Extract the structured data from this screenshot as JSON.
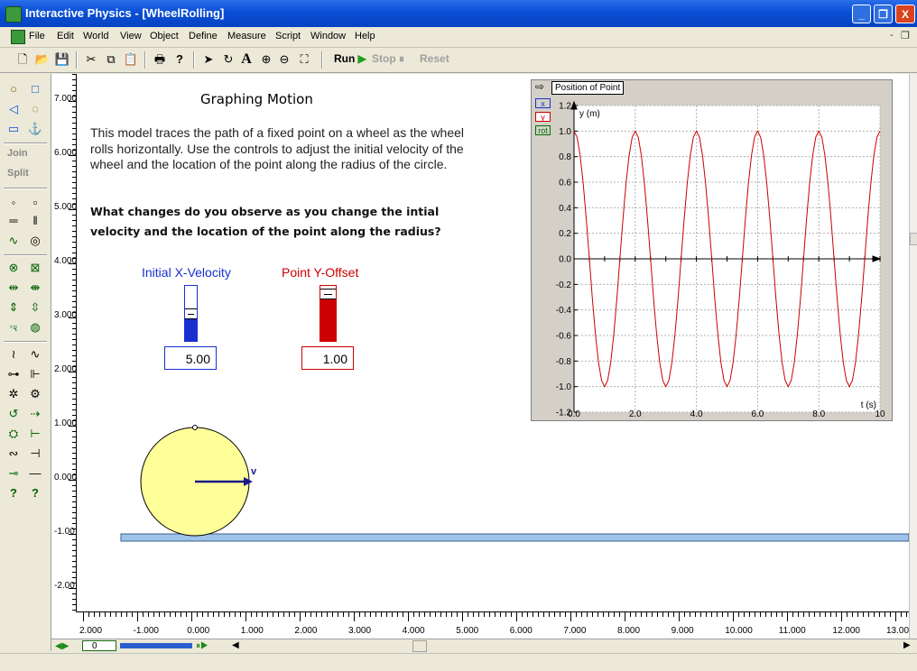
{
  "window": {
    "title": "Interactive Physics - [WheelRolling]",
    "controls": [
      "_",
      "❐",
      "X"
    ]
  },
  "menu": {
    "items": [
      "File",
      "Edit",
      "World",
      "View",
      "Object",
      "Define",
      "Measure",
      "Script",
      "Window",
      "Help"
    ],
    "mdi_controls": [
      "-",
      "❐"
    ]
  },
  "toolbar": {
    "run_label": "Run",
    "stop_label": "Stop",
    "reset_label": "Reset",
    "text_tool": "A"
  },
  "palette": {
    "join_label": "Join",
    "split_label": "Split"
  },
  "content": {
    "heading": "Graphing Motion",
    "description": "This model traces the path of a fixed point on a wheel as the wheel rolls horizontally.  Use the controls to adjust the initial velocity of the wheel and the location of the point along the radius of the circle.",
    "question": "What changes do you observe as you change the intial velocity and the location of the point along the radius?"
  },
  "controls": {
    "velocity": {
      "label": "Initial X-Velocity",
      "value": "5.00",
      "color": "#1a2fd0",
      "level": 0.5
    },
    "offset": {
      "label": "Point  Y-Offset",
      "value": "1.00",
      "color": "#cc0000",
      "level": 0.85
    }
  },
  "scene": {
    "velocity_label": "v",
    "wheel_color": "#ffff99",
    "ground_color": "#9fc3ea"
  },
  "rulers": {
    "vertical": [
      "7.000",
      "6.000",
      "5.000",
      "4.000",
      "3.000",
      "2.000",
      "1.000",
      "0.000",
      "-1.00",
      "-2.00"
    ],
    "horizontal": [
      "2.000",
      "-1.000",
      "0.000",
      "1.000",
      "2.000",
      "3.000",
      "4.000",
      "5.000",
      "6.000",
      "7.000",
      "8.000",
      "9.000",
      "10.000",
      "11.000",
      "12.000",
      "13.00"
    ]
  },
  "frame": {
    "value": "0"
  },
  "graph": {
    "window_title": "Position of Point",
    "legend": [
      "x",
      "y",
      "rot"
    ],
    "chart_data": {
      "type": "line",
      "ylabel": "y (m)",
      "xlabel": "t (s)",
      "xlim": [
        0,
        10
      ],
      "ylim": [
        -1.2,
        1.2
      ],
      "x_ticks": [
        "0.0",
        "2.0",
        "4.0",
        "6.0",
        "8.0",
        "10"
      ],
      "y_ticks": [
        "1.2",
        "1.0",
        "0.8",
        "0.6",
        "0.4",
        "0.2",
        "0.0",
        "-0.2",
        "-0.4",
        "-0.6",
        "-0.8",
        "-1.0",
        "-1.2"
      ],
      "grid": true,
      "series": [
        {
          "color": "#cc0000",
          "x": [
            0,
            0.1,
            0.2,
            0.3,
            0.4,
            0.5,
            0.6,
            0.7,
            0.8,
            0.9,
            1.0,
            1.1,
            1.2,
            1.3,
            1.4,
            1.5,
            1.6,
            1.7,
            1.8,
            1.9,
            2.0,
            2.1,
            2.2,
            2.3,
            2.4,
            2.5,
            2.6,
            2.7,
            2.8,
            2.9,
            3.0,
            3.1,
            3.2,
            3.3,
            3.4,
            3.5,
            3.6,
            3.7,
            3.8,
            3.9,
            4.0,
            4.1,
            4.2,
            4.3,
            4.4,
            4.5,
            4.6,
            4.7,
            4.8,
            4.9,
            5.0,
            5.1,
            5.2,
            5.3,
            5.4,
            5.5,
            5.6,
            5.7,
            5.8,
            5.9,
            6.0,
            6.1,
            6.2,
            6.3,
            6.4,
            6.5,
            6.6,
            6.7,
            6.8,
            6.9,
            7.0,
            7.1,
            7.2,
            7.3,
            7.4,
            7.5,
            7.6,
            7.7,
            7.8,
            7.9,
            8.0,
            8.1,
            8.2,
            8.3,
            8.4,
            8.5,
            8.6,
            8.7,
            8.8,
            8.9,
            9.0,
            9.1,
            9.2,
            9.3,
            9.4,
            9.5,
            9.6,
            9.7,
            9.8,
            9.9,
            10.0
          ],
          "values": [
            1.0,
            0.951,
            0.809,
            0.588,
            0.309,
            0.0,
            -0.309,
            -0.588,
            -0.809,
            -0.951,
            -1.0,
            -0.951,
            -0.809,
            -0.588,
            -0.309,
            0.0,
            0.309,
            0.588,
            0.809,
            0.951,
            1.0,
            0.951,
            0.809,
            0.588,
            0.309,
            0.0,
            -0.309,
            -0.588,
            -0.809,
            -0.951,
            -1.0,
            -0.951,
            -0.809,
            -0.588,
            -0.309,
            0.0,
            0.309,
            0.588,
            0.809,
            0.951,
            1.0,
            0.951,
            0.809,
            0.588,
            0.309,
            0.0,
            -0.309,
            -0.588,
            -0.809,
            -0.951,
            -1.0,
            -0.951,
            -0.809,
            -0.588,
            -0.309,
            0.0,
            0.309,
            0.588,
            0.809,
            0.951,
            1.0,
            0.951,
            0.809,
            0.588,
            0.309,
            0.0,
            -0.309,
            -0.588,
            -0.809,
            -0.951,
            -1.0,
            -0.951,
            -0.809,
            -0.588,
            -0.309,
            0.0,
            0.309,
            0.588,
            0.809,
            0.951,
            1.0,
            0.951,
            0.809,
            0.588,
            0.309,
            0.0,
            -0.309,
            -0.588,
            -0.809,
            -0.951,
            -1.0,
            -0.951,
            -0.809,
            -0.588,
            -0.309,
            0.0,
            0.309,
            0.588,
            0.809,
            0.951,
            1.0
          ]
        }
      ]
    }
  }
}
